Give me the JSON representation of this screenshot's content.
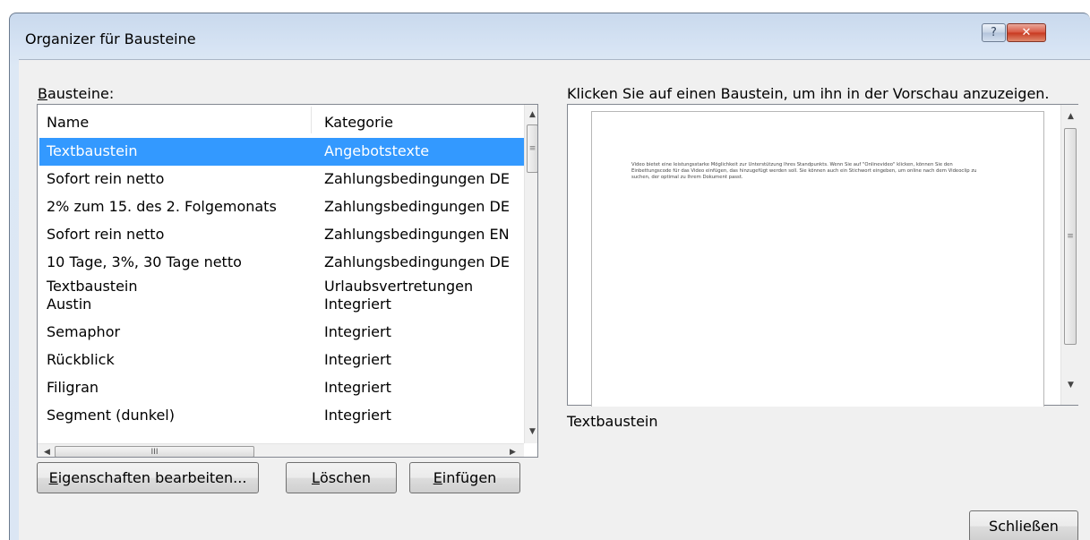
{
  "window": {
    "title": "Organizer für Bausteine",
    "help_glyph": "?",
    "close_glyph": "✕"
  },
  "list": {
    "label_hotkey": "B",
    "label_rest": "austeine:",
    "columns": [
      "Name",
      "Kategorie"
    ],
    "rows": [
      {
        "name": "Textbaustein",
        "category": "Angebotstexte",
        "selected": true
      },
      {
        "name": "Sofort rein netto",
        "category": "Zahlungsbedingungen DE"
      },
      {
        "name": "2% zum 15. des 2. Folgemonats",
        "category": "Zahlungsbedingungen DE"
      },
      {
        "name": "Sofort rein netto",
        "category": "Zahlungsbedingungen EN"
      },
      {
        "name": "10 Tage, 3%, 30 Tage netto",
        "category": "Zahlungsbedingungen DE"
      },
      {
        "name": "Textbaustein",
        "category": "Urlaubsvertretungen",
        "name2": "Austin",
        "category2": "Integriert"
      },
      {
        "name": "Semaphor",
        "category": "Integriert"
      },
      {
        "name": "Rückblick",
        "category": "Integriert"
      },
      {
        "name": "Filigran",
        "category": "Integriert"
      },
      {
        "name": "Segment (dunkel)",
        "category": "Integriert"
      }
    ],
    "hscroll_grip": "III",
    "vscroll_grip": "≡"
  },
  "buttons": {
    "edit": {
      "hotkey": "E",
      "rest": "igenschaften bearbeiten..."
    },
    "delete": {
      "hotkey": "L",
      "rest": "öschen"
    },
    "insert": {
      "hotkey": "E",
      "rest": "infügen"
    },
    "close": "Schließen"
  },
  "preview": {
    "instruction": "Klicken Sie auf einen Baustein, um ihn in der Vorschau anzuzeigen.",
    "body_text": "Video bietet eine leistungsstarke Möglichkeit zur Unterstützung Ihres Standpunkts. Wenn Sie auf \"Onlinevideo\" klicken, können Sie den Einbettungscode für das Video einfügen, das hinzugefügt werden soll. Sie können auch ein Stichwort eingeben, um online nach dem Videoclip zu suchen, der optimal zu Ihrem Dokument passt.",
    "selected_name": "Textbaustein"
  }
}
